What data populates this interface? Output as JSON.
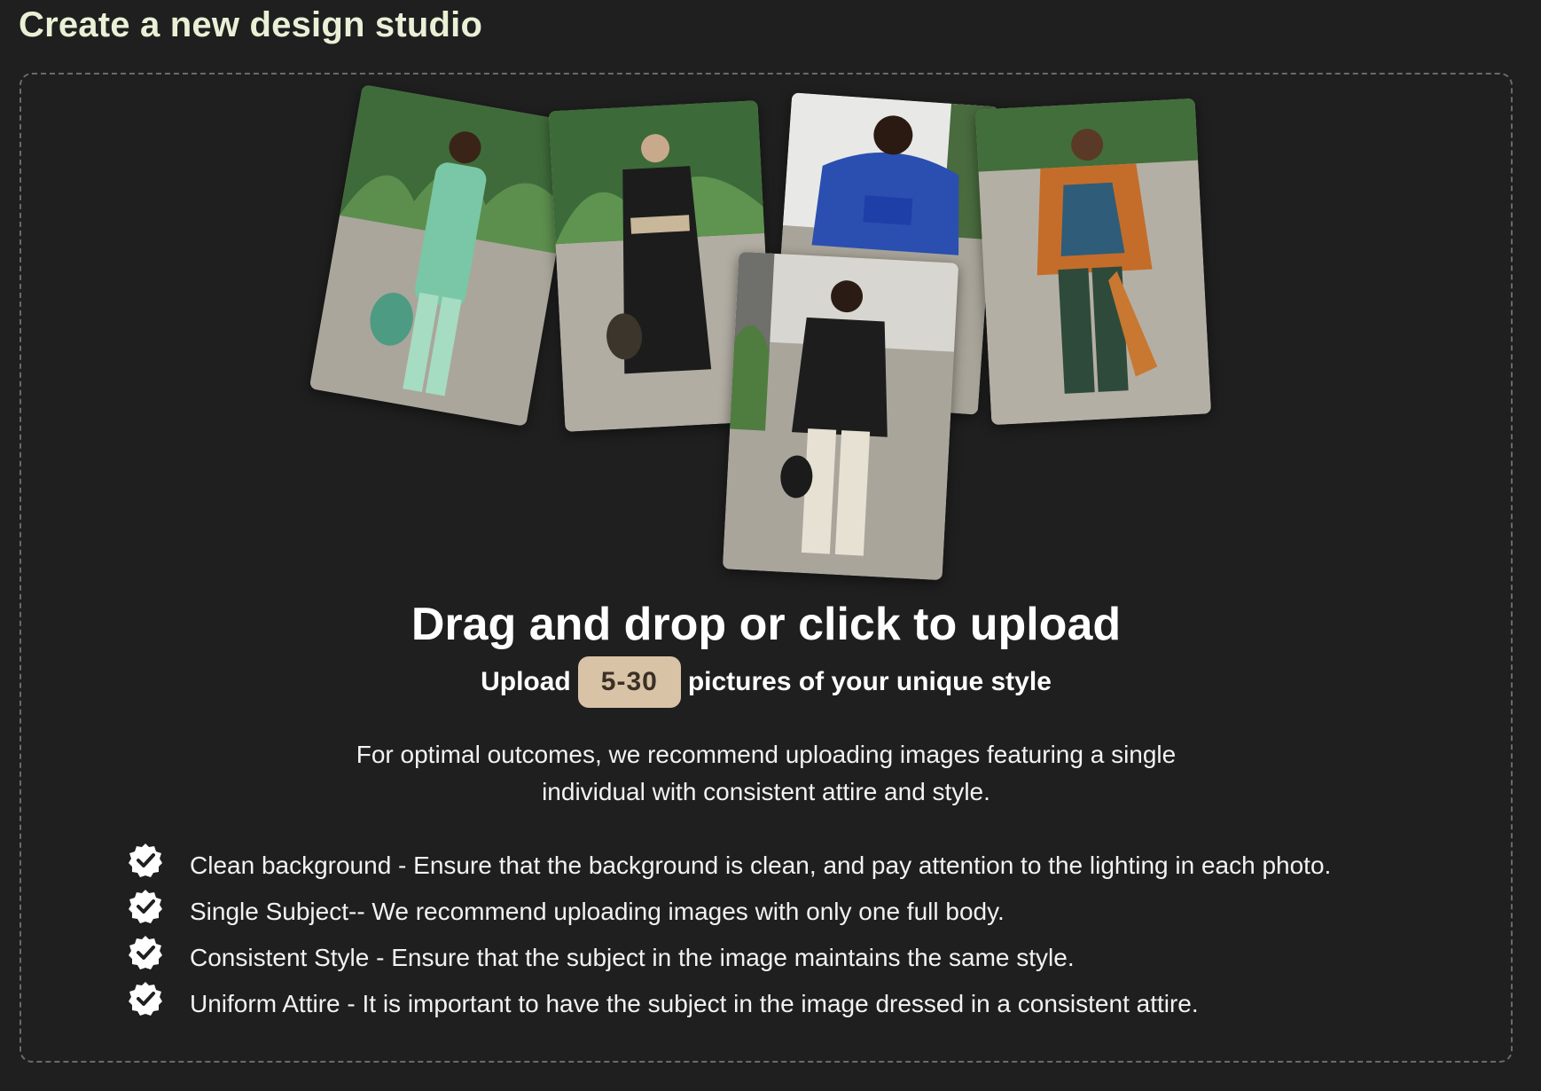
{
  "page": {
    "title": "Create a new design studio"
  },
  "upload": {
    "heading": "Drag and drop or click to upload",
    "prefix": "Upload",
    "count": "5-30",
    "suffix": "pictures of your unique style",
    "recommendation_line1": "For optimal outcomes, we recommend uploading images featuring a single",
    "recommendation_line2": "individual with consistent attire and style."
  },
  "tips": [
    {
      "text": "Clean background - Ensure that the background is clean, and pay attention to the lighting in each photo."
    },
    {
      "text": "Single Subject-- We recommend uploading images with only one full body."
    },
    {
      "text": "Consistent Style - Ensure that the subject in the image maintains the same style."
    },
    {
      "text": "Uniform Attire - It is important to have the subject in the image dressed in a consistent attire."
    }
  ],
  "colors": {
    "background": "#1f1f1f",
    "title": "#e9f0d6",
    "badge": "#d8c3a6",
    "badge_text": "#3b3026",
    "dashed_border": "#6a6a6a"
  },
  "icons": {
    "tip_check": "check-badge-icon"
  }
}
